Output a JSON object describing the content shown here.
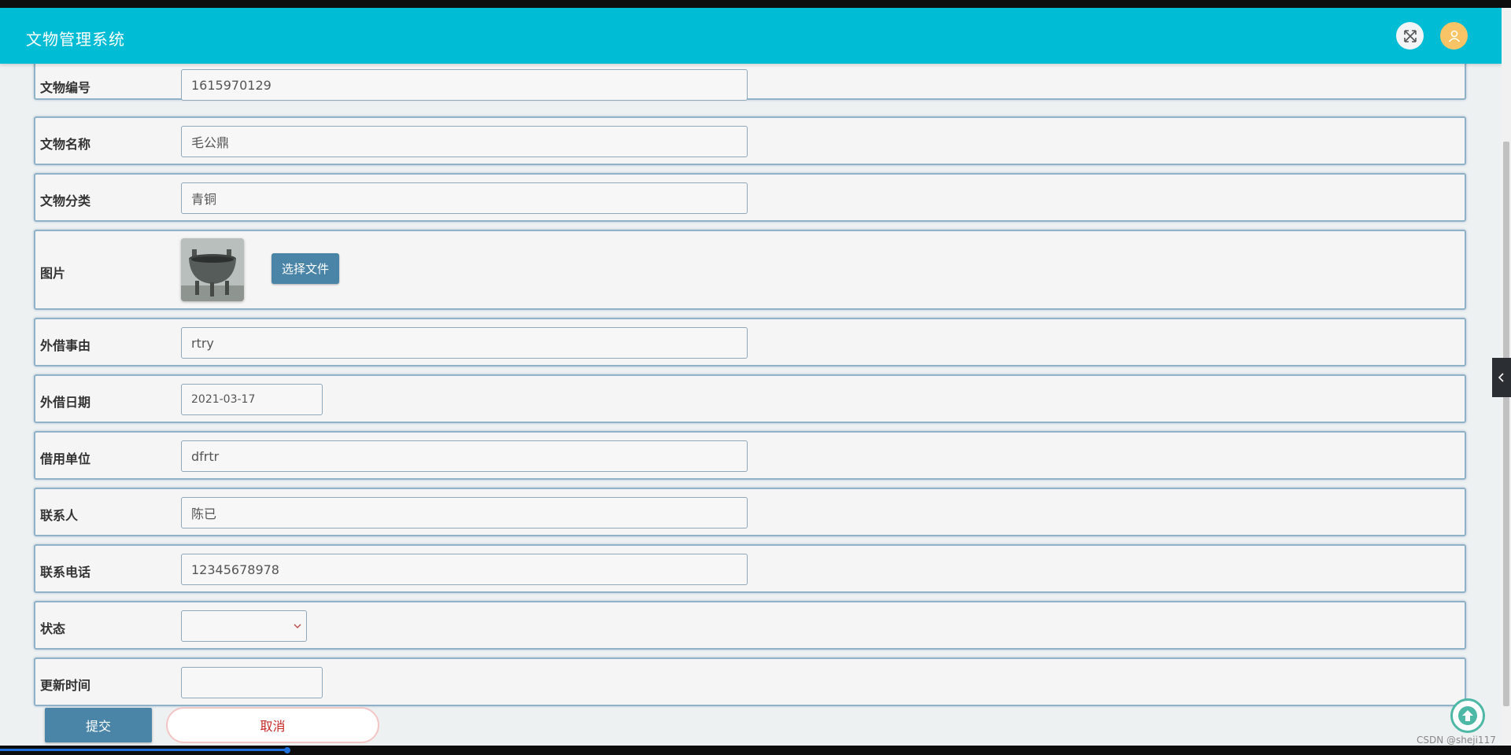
{
  "header": {
    "title": "文物管理系统",
    "expand_icon": "expand-arrows-icon",
    "user_icon": "user-icon"
  },
  "form": {
    "rows": [
      {
        "label": "文物编号",
        "value": "1615970129"
      },
      {
        "label": "文物名称",
        "value": "毛公鼎"
      },
      {
        "label": "文物分类",
        "value": "青铜"
      },
      {
        "label": "图片",
        "button": "选择文件"
      },
      {
        "label": "外借事由",
        "value": "rtry"
      },
      {
        "label": "外借日期",
        "value": "2021-03-17"
      },
      {
        "label": "借用单位",
        "value": "dfrtr"
      },
      {
        "label": "联系人",
        "value": "陈已"
      },
      {
        "label": "联系电话",
        "value": "12345678978"
      },
      {
        "label": "状态",
        "value": ""
      },
      {
        "label": "更新时间",
        "value": ""
      }
    ]
  },
  "actions": {
    "submit": "提交",
    "cancel": "取消"
  },
  "watermark": "CSDN @sheji117",
  "video_progress": 0.19,
  "colors": {
    "header": "#00bcd4",
    "primary_button": "#4a85a8",
    "cancel_text": "#c62828",
    "user_avatar": "#f8c465"
  }
}
